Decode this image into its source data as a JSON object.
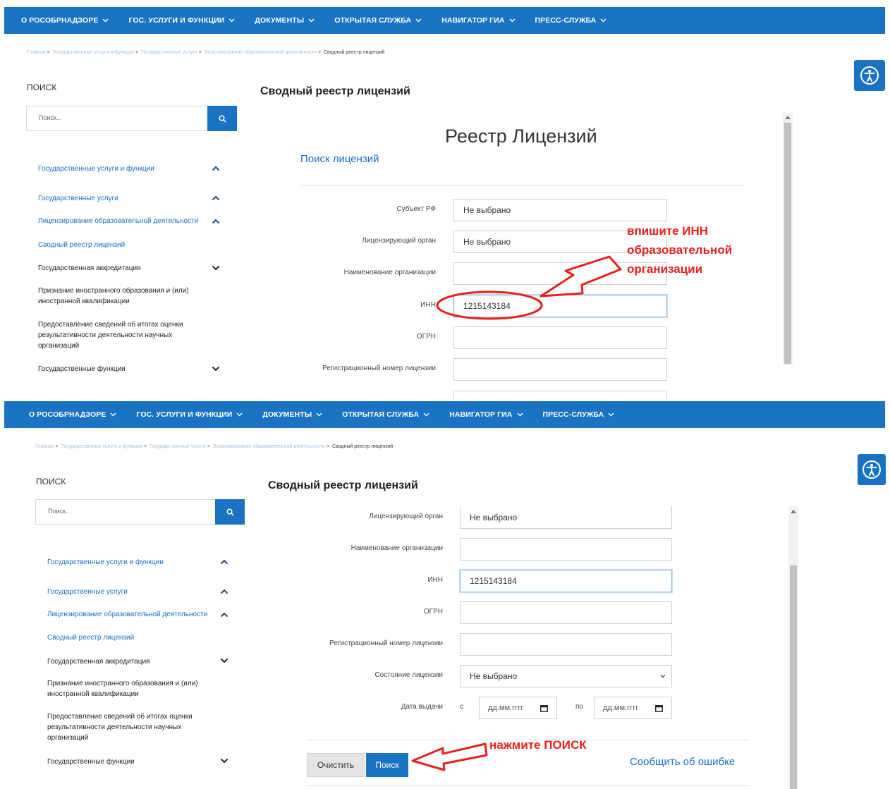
{
  "nav": {
    "items": [
      "О РОСОБРНАДЗОРЕ",
      "ГОС. УСЛУГИ И ФУНКЦИИ",
      "ДОКУМЕНТЫ",
      "ОТКРЫТАЯ СЛУЖБА",
      "НАВИГАТОР ГИА",
      "ПРЕСС-СЛУЖБА"
    ]
  },
  "breadcrumb": {
    "links": [
      "Главная",
      "Государственные услуги и функции",
      "Государственные услуги",
      "Лицензирование образовательной деятельности"
    ],
    "separator": ">",
    "current": "Сводный реестр лицензий"
  },
  "sidebar": {
    "title": "ПОИСК",
    "search_placeholder": "Поиск...",
    "items": [
      "Государственные услуги и функции",
      "Государственные услуги",
      "Лицензирование образовательной деятельности",
      "Сводный реестр лицензий",
      "Государственная аккредитация",
      "Признание иностранного образования и (или) иностранной квалификации",
      "Предоставление сведений об итогах оценки результативности деятельности научных организаций",
      "Государственные функции"
    ]
  },
  "main": {
    "title": "Сводный реестр лицензий"
  },
  "registry": {
    "heading": "Реестр Лицензий",
    "subheading": "Поиск лицензий",
    "labels": {
      "subject": "Субъект РФ",
      "authority": "Лицензирующий орган",
      "org_name": "Наименование организации",
      "inn": "ИНН",
      "ogrn": "ОГРН",
      "reg_number": "Регистрационный номер лицензии",
      "status": "Состояние лицензии",
      "issue_date": "Дата выдачи",
      "from": "с",
      "to": "по"
    },
    "values": {
      "subject": "Не выбрано",
      "authority": "Не выбрано",
      "inn": "1215143184",
      "status": "Не выбрано"
    },
    "date_placeholder": "дд.мм.гггг",
    "buttons": {
      "clear": "Очистить",
      "search": "Поиск"
    },
    "report_link": "Сообщить об ошибке"
  },
  "annotations": {
    "inn_hint": [
      "впишите ИНН",
      "образовательной",
      "организации"
    ],
    "search_hint": "нажмите ПОИСК",
    "color": "#e8211e"
  },
  "colors": {
    "brand_blue": "#1a73c2",
    "link_blue": "#1a6ec0"
  }
}
